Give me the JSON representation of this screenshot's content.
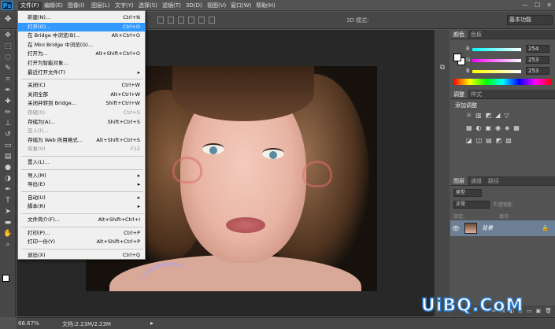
{
  "app": {
    "logo": "Ps"
  },
  "menubar": {
    "items": [
      "文件(F)",
      "编辑(E)",
      "图像(I)",
      "图层(L)",
      "文字(Y)",
      "选择(S)",
      "滤镜(T)",
      "3D(D)",
      "视图(V)",
      "窗口(W)",
      "帮助(H)"
    ],
    "window_controls": [
      "—",
      "☐",
      "✕"
    ]
  },
  "optionsbar": {
    "mode_label": "3D 模式:",
    "workspace": "基本功能"
  },
  "file_menu": {
    "items": [
      {
        "label": "新建(N)...",
        "shortcut": "Ctrl+N",
        "disabled": false,
        "hover": false
      },
      {
        "label": "打开(O)...",
        "shortcut": "Ctrl+O",
        "disabled": false,
        "hover": true
      },
      {
        "label": "在 Bridge 中浏览(B)...",
        "shortcut": "Alt+Ctrl+O",
        "disabled": false,
        "hover": false
      },
      {
        "label": "在 Mini Bridge 中浏览(G)...",
        "shortcut": "",
        "disabled": false,
        "hover": false
      },
      {
        "label": "打开为...",
        "shortcut": "Alt+Shift+Ctrl+O",
        "disabled": false,
        "hover": false
      },
      {
        "label": "打开为智能对象...",
        "shortcut": "",
        "disabled": false,
        "hover": false
      },
      {
        "label": "最近打开文件(T)",
        "shortcut": "▸",
        "disabled": false,
        "hover": false
      },
      {
        "label": "关闭(C)",
        "shortcut": "Ctrl+W",
        "disabled": false,
        "hover": false
      },
      {
        "label": "关闭全部",
        "shortcut": "Alt+Ctrl+W",
        "disabled": false,
        "hover": false
      },
      {
        "label": "关闭并转到 Bridge...",
        "shortcut": "Shift+Ctrl+W",
        "disabled": false,
        "hover": false
      },
      {
        "label": "存储(S)",
        "shortcut": "Ctrl+S",
        "disabled": true,
        "hover": false
      },
      {
        "label": "存储为(A)...",
        "shortcut": "Shift+Ctrl+S",
        "disabled": false,
        "hover": false
      },
      {
        "label": "签入(I)...",
        "shortcut": "",
        "disabled": true,
        "hover": false
      },
      {
        "label": "存储为 Web 所用格式...",
        "shortcut": "Alt+Shift+Ctrl+S",
        "disabled": false,
        "hover": false
      },
      {
        "label": "恢复(V)",
        "shortcut": "F12",
        "disabled": true,
        "hover": false
      },
      {
        "label": "置入(L)...",
        "shortcut": "",
        "disabled": false,
        "hover": false
      },
      {
        "label": "导入(M)",
        "shortcut": "▸",
        "disabled": false,
        "hover": false
      },
      {
        "label": "导出(E)",
        "shortcut": "▸",
        "disabled": false,
        "hover": false
      },
      {
        "label": "自动(U)",
        "shortcut": "▸",
        "disabled": false,
        "hover": false
      },
      {
        "label": "脚本(R)",
        "shortcut": "▸",
        "disabled": false,
        "hover": false
      },
      {
        "label": "文件简介(F)...",
        "shortcut": "Alt+Shift+Ctrl+I",
        "disabled": false,
        "hover": false
      },
      {
        "label": "打印(P)...",
        "shortcut": "Ctrl+P",
        "disabled": false,
        "hover": false
      },
      {
        "label": "打印一份(Y)",
        "shortcut": "Alt+Shift+Ctrl+P",
        "disabled": false,
        "hover": false
      },
      {
        "label": "退出(X)",
        "shortcut": "Ctrl+Q",
        "disabled": false,
        "hover": false
      }
    ]
  },
  "color_panel": {
    "tabs": [
      "颜色",
      "色板"
    ],
    "channels": [
      {
        "label": "R",
        "value": "254",
        "color": "#ff4a4a"
      },
      {
        "label": "G",
        "value": "253",
        "color": "#4aff4a"
      },
      {
        "label": "B",
        "value": "253",
        "color": "#4a4aff"
      }
    ]
  },
  "adjustments_panel": {
    "tabs": [
      "调整",
      "样式"
    ],
    "title": "添加调整",
    "row1": [
      "☼",
      "▥",
      "◩",
      "◢",
      "▽"
    ],
    "row2": [
      "▦",
      "◐",
      "▣",
      "◉",
      "◈",
      "▦"
    ],
    "row3": [
      "◪",
      "◫",
      "▤",
      "◩",
      "▧"
    ]
  },
  "layers_panel": {
    "tabs": [
      "图层",
      "通道",
      "路径"
    ],
    "kind_filter": "类型",
    "blend_mode": "正常",
    "opacity_label": "不透明度:",
    "lock_label": "锁定:",
    "fill_label": "填充:",
    "layer_name": "背景",
    "footer_icons": [
      "∞",
      "fx",
      "◐",
      "◻",
      "▭",
      "▣",
      "🗑"
    ]
  },
  "status": {
    "zoom": "66.67%",
    "doc_info": "文档:2.23M/2.23M"
  },
  "watermark": "UiBQ.CoM",
  "colors": {
    "hover": "#3399ff",
    "layer_selected": "#6c7f95"
  }
}
